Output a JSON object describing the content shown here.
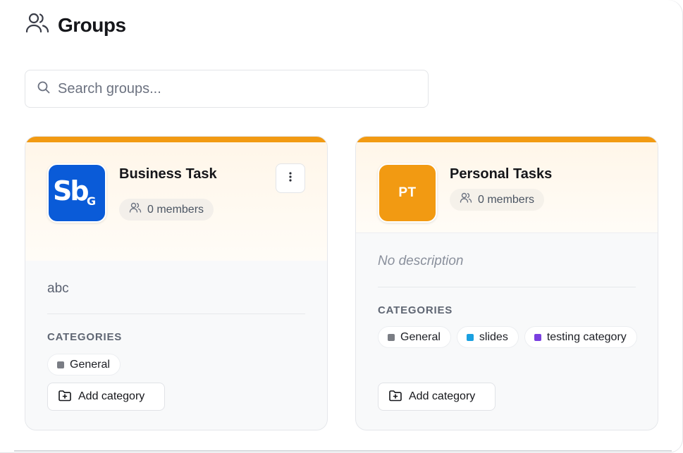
{
  "page": {
    "title": "Groups",
    "icon": "users-icon"
  },
  "search": {
    "placeholder": "Search groups...",
    "value": ""
  },
  "colors": {
    "accent": "#f29a12",
    "logo_blue": "#0a5bd8"
  },
  "groups": [
    {
      "name": "Business Task",
      "avatar": {
        "type": "logo",
        "icon": "sbg-logo-icon"
      },
      "members": "0 members",
      "description": "abc",
      "categories_label": "CATEGORIES",
      "categories": [
        {
          "name": "General",
          "color": "#7a7d84"
        }
      ],
      "add_category_label": "Add category",
      "has_menu": true
    },
    {
      "name": "Personal Tasks",
      "avatar": {
        "type": "initials",
        "text": "PT"
      },
      "members": "0 members",
      "description": "No description",
      "categories_label": "CATEGORIES",
      "categories": [
        {
          "name": "General",
          "color": "#7a7d84"
        },
        {
          "name": "slides",
          "color": "#1aa0e0"
        },
        {
          "name": "testing category",
          "color": "#7a3fe0"
        }
      ],
      "add_category_label": "Add category",
      "has_menu": false
    }
  ]
}
